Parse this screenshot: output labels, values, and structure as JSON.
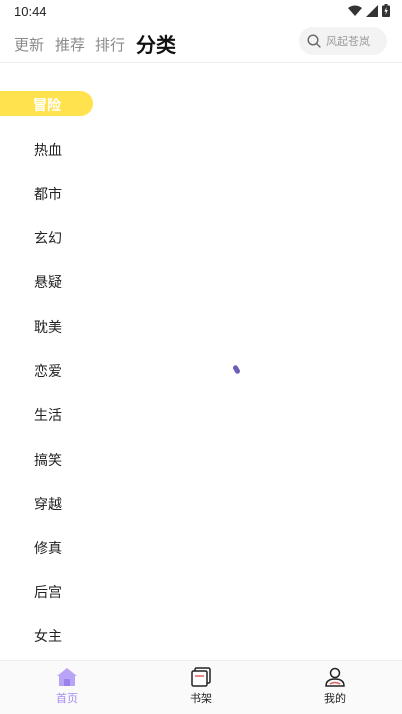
{
  "status_bar": {
    "time": "10:44"
  },
  "top_tabs": [
    {
      "label": "更新",
      "active": false
    },
    {
      "label": "推荐",
      "active": false
    },
    {
      "label": "排行",
      "active": false
    },
    {
      "label": "分类",
      "active": true
    }
  ],
  "search": {
    "placeholder": "风起苍岚"
  },
  "categories": {
    "selected": "冒险",
    "items": [
      "热血",
      "都市",
      "玄幻",
      "悬疑",
      "耽美",
      "恋爱",
      "生活",
      "搞笑",
      "穿越",
      "修真",
      "后宫",
      "女主"
    ]
  },
  "bottom_nav": [
    {
      "label": "首页",
      "icon": "home-icon",
      "active": true
    },
    {
      "label": "书架",
      "icon": "bookshelf-icon",
      "active": false
    },
    {
      "label": "我的",
      "icon": "profile-icon",
      "active": false
    }
  ],
  "colors": {
    "accent_yellow": "#ffe24d",
    "accent_purple": "#a58cf0",
    "spinner": "#6a5fb8"
  }
}
